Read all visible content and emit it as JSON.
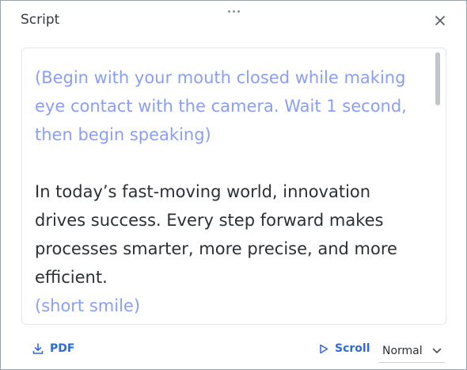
{
  "header": {
    "title": "Script",
    "close_icon": "close-icon",
    "drag_icon": "drag-handle-icon"
  },
  "script": {
    "direction_intro": "(Begin with your mouth closed while making eye contact with the camera. Wait 1 second, then begin speaking)",
    "body": "In today’s fast-moving world, innovation drives success. Every step forward makes processes smarter, more precise, and more efficient.",
    "direction_end": "(short smile)"
  },
  "footer": {
    "pdf_label": "PDF",
    "pdf_icon": "download-icon",
    "scroll_label": "Scroll",
    "scroll_icon": "play-icon",
    "speed_value": "Normal",
    "speed_icon": "chevron-down-icon"
  },
  "colors": {
    "accent": "#2e6ad8",
    "direction_text": "#8a9ff3",
    "body_text": "#2b3036"
  }
}
